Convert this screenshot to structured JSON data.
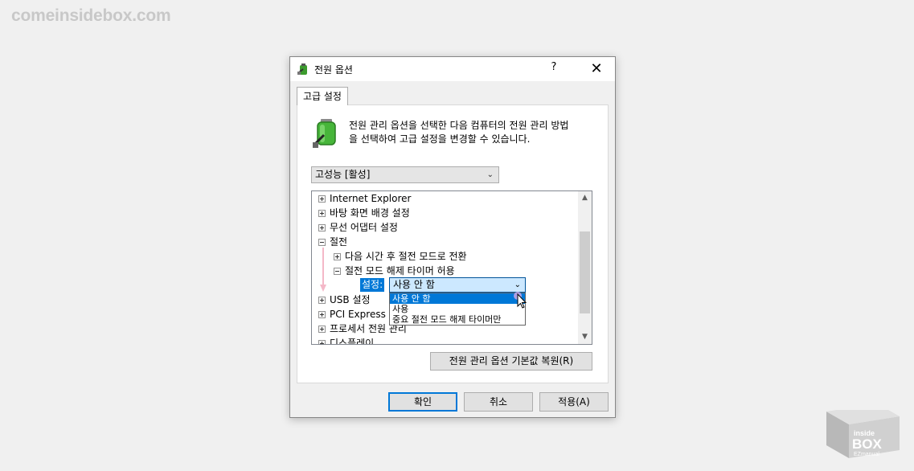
{
  "watermark": "comeinsidebox.com",
  "dialog": {
    "title": "전원 옵션",
    "help": "?",
    "close": "✕",
    "tab": "고급 설정",
    "description_line1": "전원 관리 옵션을 선택한 다음 컴퓨터의 전원 관리 방법",
    "description_line2": "을 선택하여 고급 설정을 변경할 수 있습니다.",
    "plan": "고성능 [활성]",
    "tree": [
      {
        "label": "Internet Explorer",
        "expander": "plus"
      },
      {
        "label": "바탕 화면 배경 설정",
        "expander": "plus"
      },
      {
        "label": "무선 어댑터 설정",
        "expander": "plus"
      },
      {
        "label": "절전",
        "expander": "minus"
      },
      {
        "label": "다음 시간 후 절전 모드로 전환",
        "expander": "plus"
      },
      {
        "label": "절전 모드 해제 타이머 허용",
        "expander": "minus"
      },
      {
        "label": "USB 설정",
        "expander": "plus"
      },
      {
        "label": "PCI Express",
        "expander": "plus"
      },
      {
        "label": "프로세서 전원 관리",
        "expander": "plus"
      },
      {
        "label": "디스플레이",
        "expander": "plus"
      }
    ],
    "setting_label": "설정:",
    "setting_value": "사용 안 함",
    "options": [
      "사용 안 함",
      "사용",
      "중요 절전 모드 해제 타이머만"
    ],
    "restore_button": "전원 관리 옵션 기본값 복원(R)",
    "ok": "확인",
    "cancel": "취소",
    "apply": "적용(A)"
  },
  "logo": {
    "top": "inside",
    "main": "BOX",
    "sub": "EZmanual"
  },
  "colors": {
    "accent": "#0078d7",
    "selection_light": "#cce8ff",
    "annotation": "#f4b8c8"
  }
}
